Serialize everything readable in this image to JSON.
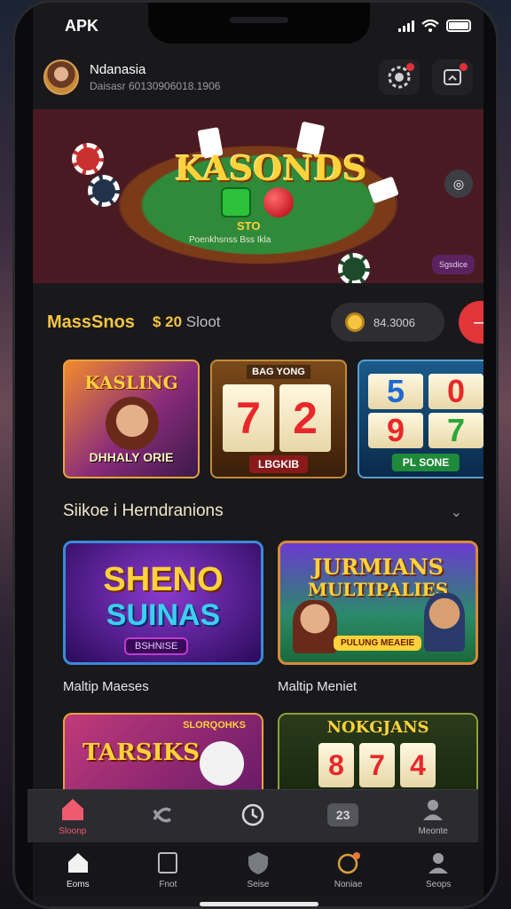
{
  "status": {
    "carrier_label": "APK"
  },
  "header": {
    "user_name": "Ndanasia",
    "user_sub": "Daisasr 60130906018.1906",
    "notif_icon": "chip-icon",
    "message_icon": "message-icon",
    "accent": "#e2303a"
  },
  "hero": {
    "title": "KASONDS",
    "sub": "STO",
    "small": "Poenkhsnss Bss Ikla",
    "badge": "Sgsdice"
  },
  "promo": {
    "title": "MassSnos",
    "slot_prefix": "$ 20",
    "slot_suffix": "Sloot",
    "coin_value": "84.3006",
    "arrow": "⟶"
  },
  "slots": [
    {
      "top": "KASLING",
      "bottom": "DHHALY ORIE"
    },
    {
      "top": "BAG YONG",
      "reel1": "7",
      "reel2": "2",
      "bottom": "LBGKIB"
    },
    {
      "top": "",
      "reel1": "5",
      "reel2": "0",
      "reel3": "9",
      "reel4": "7",
      "bottom": "PL SONE"
    }
  ],
  "section": {
    "title": "Siikoe i Herndranions",
    "chevron": "⌄"
  },
  "big_cards": [
    {
      "line1": "SHENO",
      "line2": "SUINAS",
      "badge": "BSHNISE",
      "caption": "Maltip Maeses"
    },
    {
      "line1": "JURMIANS",
      "line2": "MULTIPALIES",
      "badge": "PULUNG MEAEIE",
      "caption": "Maltip Meniet"
    }
  ],
  "bottom_cards": [
    {
      "title": "TARSIKS",
      "tag": "SLORQOHKS"
    },
    {
      "title": "NOKGJANS",
      "reel1": "8",
      "reel2": "7",
      "reel3": "4"
    }
  ],
  "tabbar_top": [
    {
      "label": "Sloonp",
      "icon": "home-icon",
      "active": true
    },
    {
      "label": "",
      "icon": "shuffle-icon",
      "active": false
    },
    {
      "label": "",
      "icon": "clock-icon",
      "active": false
    },
    {
      "label": "",
      "icon": "ticket-icon",
      "badge": "23",
      "active": false
    },
    {
      "label": "Meonte",
      "icon": "profile-icon",
      "active": false
    }
  ],
  "tabbar_bottom": [
    {
      "label": "Eoms",
      "icon": "home-icon",
      "active": true
    },
    {
      "label": "Fnot",
      "icon": "card-icon",
      "active": false
    },
    {
      "label": "Seise",
      "icon": "shield-icon",
      "active": false
    },
    {
      "label": "Noniae",
      "icon": "coin-icon",
      "active": false
    },
    {
      "label": "Seops",
      "icon": "user-icon",
      "active": false
    }
  ]
}
